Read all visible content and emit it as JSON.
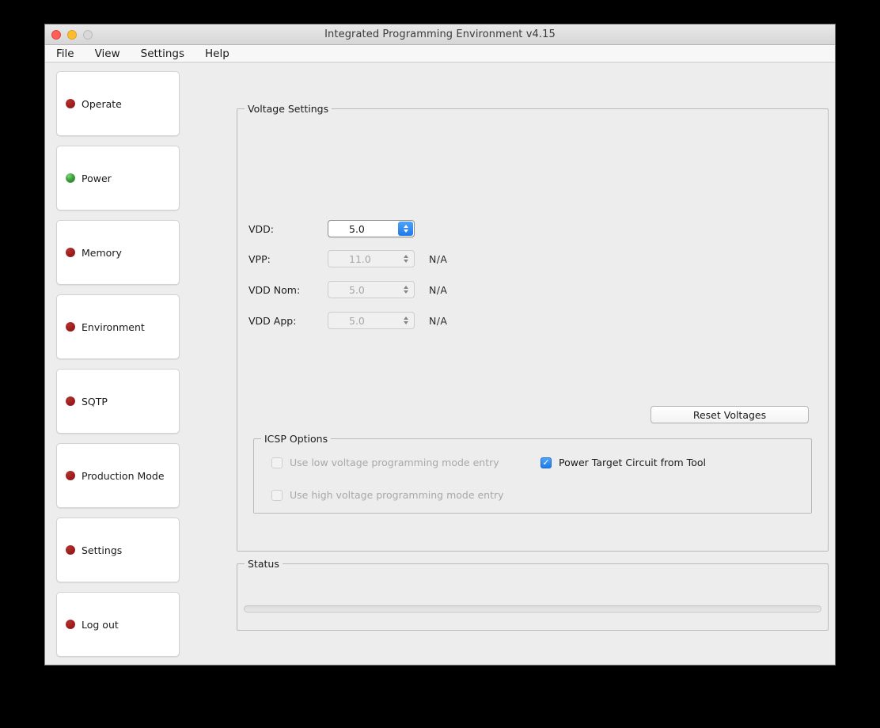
{
  "window": {
    "title": "Integrated Programming Environment v4.15",
    "traffic_lights": [
      "close",
      "minimize",
      "zoom"
    ]
  },
  "menubar": {
    "items": [
      {
        "label": "File"
      },
      {
        "label": "View"
      },
      {
        "label": "Settings"
      },
      {
        "label": "Help"
      }
    ]
  },
  "sidebar": {
    "items": [
      {
        "label": "Operate",
        "status": "red"
      },
      {
        "label": "Power",
        "status": "green"
      },
      {
        "label": "Memory",
        "status": "red"
      },
      {
        "label": "Environment",
        "status": "red"
      },
      {
        "label": "SQTP",
        "status": "red"
      },
      {
        "label": "Production Mode",
        "status": "red"
      },
      {
        "label": "Settings",
        "status": "red"
      },
      {
        "label": "Log out",
        "status": "red"
      }
    ]
  },
  "voltage_settings": {
    "title": "Voltage Settings",
    "rows": [
      {
        "label": "VDD:",
        "value": "5.0",
        "enabled": true,
        "note": ""
      },
      {
        "label": "VPP:",
        "value": "11.0",
        "enabled": false,
        "note": "N/A"
      },
      {
        "label": "VDD Nom:",
        "value": "5.0",
        "enabled": false,
        "note": "N/A"
      },
      {
        "label": "VDD App:",
        "value": "5.0",
        "enabled": false,
        "note": "N/A"
      }
    ],
    "reset_button": "Reset Voltages"
  },
  "icsp_options": {
    "title": "ICSP Options",
    "checkboxes": [
      {
        "label": "Use low voltage programming mode entry",
        "checked": false,
        "enabled": false
      },
      {
        "label": "Use high voltage programming mode entry",
        "checked": false,
        "enabled": false
      },
      {
        "label": "Power Target Circuit from Tool",
        "checked": true,
        "enabled": true
      }
    ],
    "check_glyph": "✓"
  },
  "status": {
    "title": "Status",
    "message": "",
    "progress_percent": 0
  },
  "colors": {
    "accent_blue": "#1f79e8",
    "status_red": "#9e1b1b",
    "status_green": "#3aa03a",
    "window_bg": "#ededed",
    "desktop_bg": "#000000"
  }
}
